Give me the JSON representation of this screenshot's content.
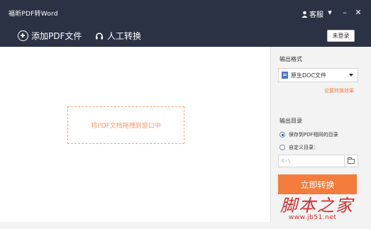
{
  "window": {
    "title": "福昕PDF转Word",
    "user_label": "客服",
    "menu_glyph": "▾",
    "minimize_glyph": "–",
    "close_glyph": "✕"
  },
  "toolbar": {
    "add_pdf_label": "添加PDF文件",
    "manual_convert_label": "人工转换",
    "login_label": "未登录"
  },
  "drop_area": {
    "hint": "将PDF文档拖拽到窗口中"
  },
  "side_panel": {
    "output_format_title": "输出格式",
    "format_selected": "原生DOC文件",
    "settings_link": "设置转换效果",
    "output_dir_title": "输出目录",
    "option_same_dir": "保存到PDF相同的目录",
    "option_custom_dir": "自定义目录：",
    "path_value": "C:\\",
    "convert_button": "立即转换"
  },
  "watermark": {
    "text": "脚本之家",
    "url": "www.jb51.net"
  },
  "colors": {
    "titlebar": "#2a3244",
    "accent_orange": "#f47c3c",
    "dashed_border": "#f4a678",
    "watermark_red": "#d92b2b"
  }
}
